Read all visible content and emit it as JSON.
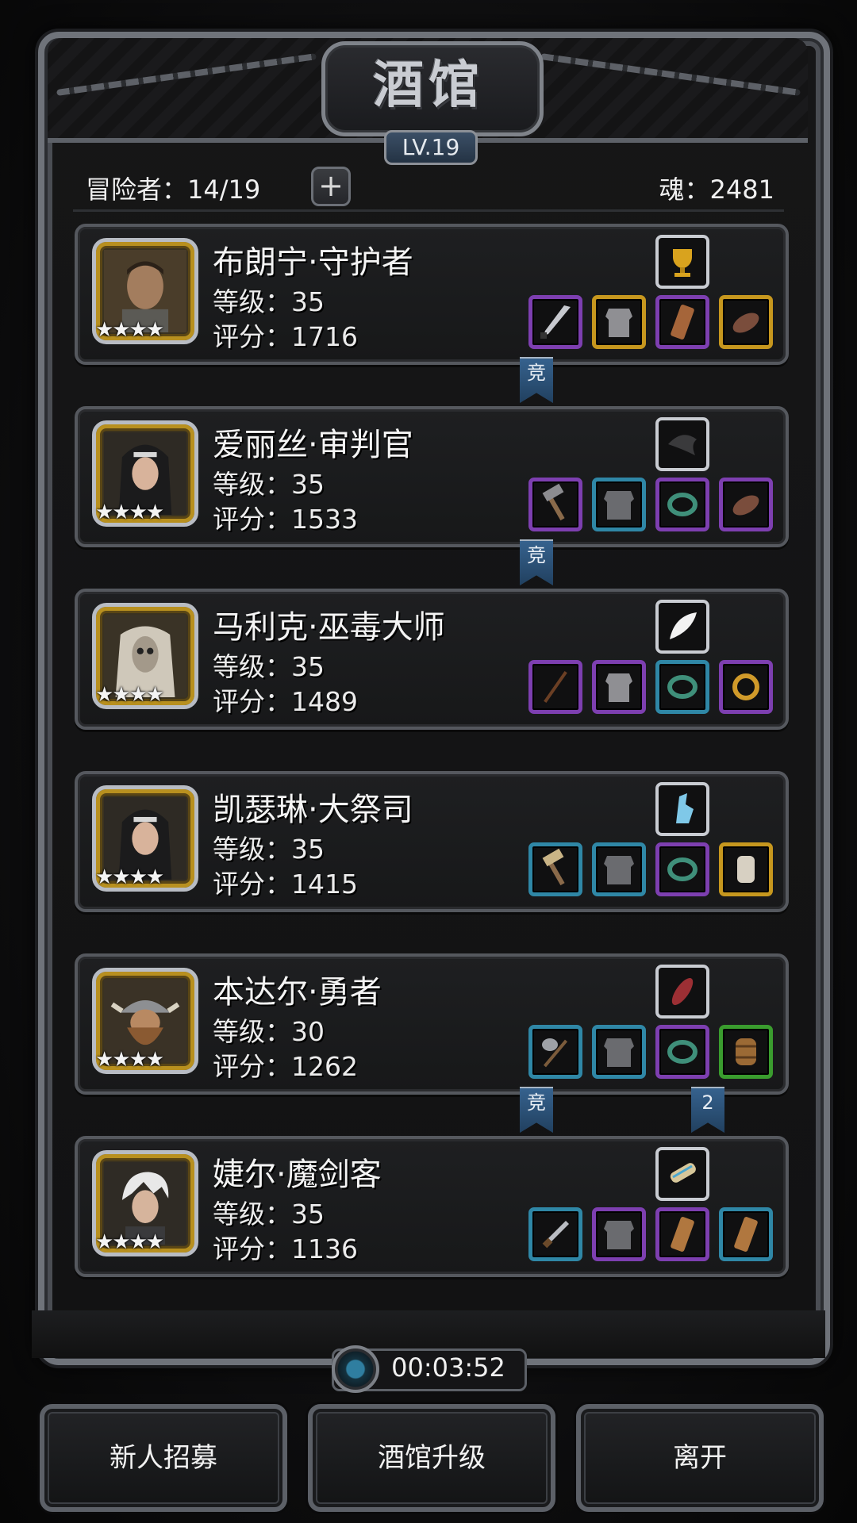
{
  "header": {
    "title": "酒馆",
    "level_badge": "LV.19"
  },
  "topbar": {
    "adventurers": "冒险者：14/19",
    "add_button": "+",
    "soul": "魂：2481"
  },
  "heroes": [
    {
      "name": "布朗宁·守护者",
      "level": "等级：35",
      "score": "评分：1716",
      "stars": "★★★★",
      "skill_icon": "trophy-icon",
      "equipment": [
        {
          "icon": "sword-icon",
          "rarity": "purple"
        },
        {
          "icon": "armor-icon",
          "rarity": "gold"
        },
        {
          "icon": "wood-bracer-icon",
          "rarity": "purple"
        },
        {
          "icon": "leather-boot-icon",
          "rarity": "gold"
        }
      ],
      "ribbons": [
        {
          "label": "竞"
        }
      ]
    },
    {
      "name": "爱丽丝·审判官",
      "level": "等级：35",
      "score": "评分：1533",
      "stars": "★★★★",
      "skill_icon": "dark-claw-icon",
      "equipment": [
        {
          "icon": "hammer-icon",
          "rarity": "purple"
        },
        {
          "icon": "armor-icon",
          "rarity": "blue"
        },
        {
          "icon": "ring-icon",
          "rarity": "purple"
        },
        {
          "icon": "leather-boot-icon",
          "rarity": "purple"
        }
      ],
      "ribbons": [
        {
          "label": "竞"
        }
      ]
    },
    {
      "name": "马利克·巫毒大师",
      "level": "等级：35",
      "score": "评分：1489",
      "stars": "★★★★",
      "skill_icon": "feather-icon",
      "equipment": [
        {
          "icon": "staff-icon",
          "rarity": "purple"
        },
        {
          "icon": "armor-icon",
          "rarity": "purple"
        },
        {
          "icon": "ring-icon",
          "rarity": "blue"
        },
        {
          "icon": "gold-ring-icon",
          "rarity": "purple"
        }
      ],
      "ribbons": []
    },
    {
      "name": "凯瑟琳·大祭司",
      "level": "等级：35",
      "score": "评分：1415",
      "stars": "★★★★",
      "skill_icon": "ice-crystal-icon",
      "equipment": [
        {
          "icon": "hammer-icon",
          "rarity": "blue"
        },
        {
          "icon": "armor-icon",
          "rarity": "blue"
        },
        {
          "icon": "ring-icon",
          "rarity": "purple"
        },
        {
          "icon": "amulet-icon",
          "rarity": "gold"
        }
      ],
      "ribbons": []
    },
    {
      "name": "本达尔·勇者",
      "level": "等级：30",
      "score": "评分：1262",
      "stars": "★★★★",
      "skill_icon": "red-pepper-icon",
      "equipment": [
        {
          "icon": "axe-icon",
          "rarity": "blue"
        },
        {
          "icon": "armor-icon",
          "rarity": "blue"
        },
        {
          "icon": "ring-icon",
          "rarity": "purple"
        },
        {
          "icon": "barrel-icon",
          "rarity": "green"
        }
      ],
      "ribbons": [
        {
          "label": "竞"
        },
        {
          "label": "2"
        }
      ]
    },
    {
      "name": "婕尔·魔剑客",
      "level": "等级：35",
      "score": "评分：1136",
      "stars": "★★★★",
      "skill_icon": "scroll-icon",
      "equipment": [
        {
          "icon": "dagger-icon",
          "rarity": "blue"
        },
        {
          "icon": "armor-icon",
          "rarity": "purple"
        },
        {
          "icon": "wood-bracer-icon",
          "rarity": "purple"
        },
        {
          "icon": "wood-bracer-icon",
          "rarity": "blue"
        }
      ],
      "ribbons": []
    }
  ],
  "timer": {
    "value": "00:03:52",
    "icon": "clock-icon"
  },
  "buttons": {
    "recruit": "新人招募",
    "upgrade": "酒馆升级",
    "leave": "离开"
  },
  "colors": {
    "purple": "#7d3fb0",
    "gold": "#c6971e",
    "blue": "#2f87a6",
    "green": "#3a9c2e",
    "ribbon": "#2b4f73"
  }
}
